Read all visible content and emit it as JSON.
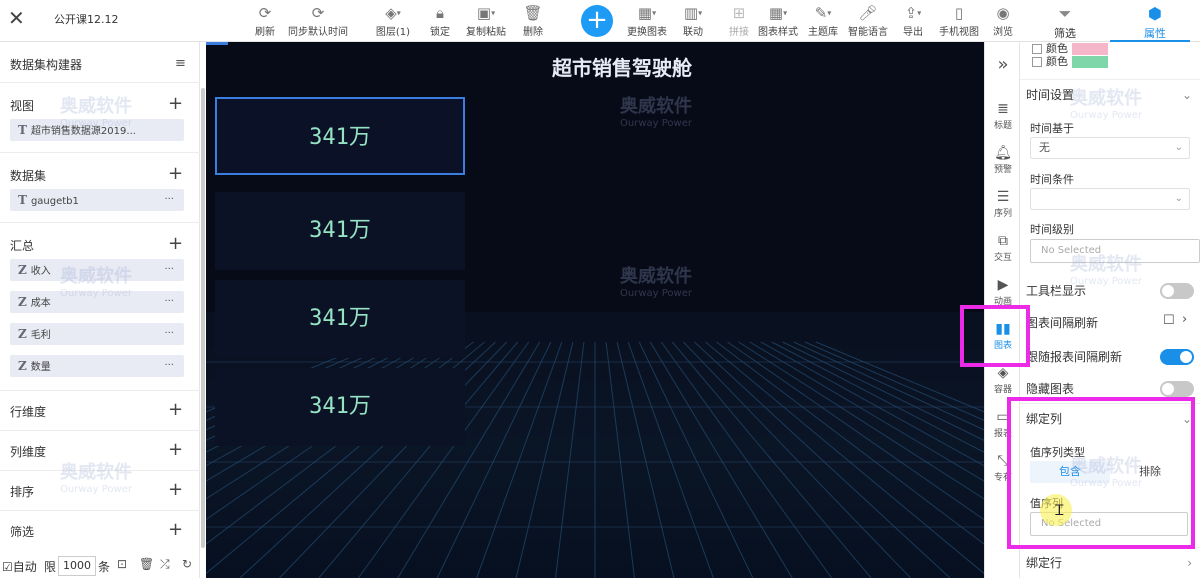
{
  "app": {
    "doc_title": "公开课12.12"
  },
  "toolbar": {
    "items": [
      {
        "icon": "refresh-icon",
        "label": "刷新"
      },
      {
        "icon": "sync-icon",
        "label": "同步默认时间"
      },
      {
        "icon": "layers-icon",
        "label": "图层(1)"
      },
      {
        "icon": "lock-icon",
        "label": "锁定"
      },
      {
        "icon": "copy-paste-icon",
        "label": "复制粘贴"
      },
      {
        "icon": "trash-icon",
        "label": "删除"
      },
      {
        "icon": "change-chart-icon",
        "label": "更换图表"
      },
      {
        "icon": "link-icon",
        "label": "联动"
      },
      {
        "icon": "tile-icon",
        "label": "拼接"
      },
      {
        "icon": "chart-style-icon",
        "label": "图表样式"
      },
      {
        "icon": "theme-icon",
        "label": "主题库"
      },
      {
        "icon": "mic-icon",
        "label": "智能语言"
      },
      {
        "icon": "export-icon",
        "label": "导出"
      },
      {
        "icon": "phone-icon",
        "label": "手机视图"
      },
      {
        "icon": "eye-icon",
        "label": "浏览"
      }
    ],
    "tab_filter": "筛选",
    "tab_props": "属性"
  },
  "left": {
    "title": "数据集构建器",
    "view_label": "视图",
    "view_item": "超市销售数据源2019...",
    "dataset_label": "数据集",
    "dataset_item": "gaugetb1",
    "summary_label": "汇总",
    "measures": [
      "收入",
      "成本",
      "毛利",
      "数量"
    ],
    "row_dim": "行维度",
    "col_dim": "列维度",
    "sort": "排序",
    "filter": "筛选",
    "auto": "自动",
    "limit_prefix": "限",
    "limit_value": "1000",
    "limit_suffix": "条",
    "type_text": "T",
    "type_measure": "Z",
    "dots": "···"
  },
  "canvas": {
    "title": "超市销售驾驶舱",
    "cards": [
      "341万",
      "341万",
      "341万",
      "341万"
    ]
  },
  "iconstrip": {
    "expand": "»",
    "items": [
      "标题",
      "预警",
      "序列",
      "交互",
      "动画",
      "图表",
      "容器",
      "报表",
      "专有"
    ]
  },
  "right": {
    "color_a": "颜色",
    "color_b": "颜色",
    "swatch_a": "#f4b6c8",
    "swatch_b": "#7fd6a8",
    "time_section": "时间设置",
    "time_based": "时间基于",
    "time_based_value": "无",
    "time_cond": "时间条件",
    "time_level": "时间级别",
    "no_selected": "No Selected",
    "toolbar_show": "工具栏显示",
    "refresh_interval": "图表间隔刷新",
    "follow_refresh": "跟随报表间隔刷新",
    "hide_chart": "隐藏图表",
    "bind_col": "绑定列",
    "seq_type": "值序列类型",
    "include": "包含",
    "exclude": "排除",
    "seq_col": "值序列",
    "bind_row": "绑定行"
  },
  "watermark": {
    "cn": "奥威软件",
    "en": "Ourway Power"
  }
}
